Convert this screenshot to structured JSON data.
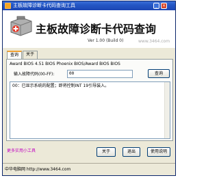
{
  "window": {
    "title": "主板故障诊断卡代码查询工具",
    "minimize_glyph": "_",
    "close_glyph": "×"
  },
  "header": {
    "app_title": "主板故障诊断卡代码查询",
    "version": "Ver 1.00 (Build 0)",
    "watermark": "www.3464.com",
    "logo_icon": "first-aid-kit-icon"
  },
  "tabs": [
    {
      "label": "查询"
    },
    {
      "label": "关于"
    }
  ],
  "panel": {
    "bios_line": "Award BIOS 4.51 BIOS Phoenix BIOS/Award BIOS BIOS",
    "code_label": "输入故障代码(00-FF):",
    "code_value": "00",
    "query_button": "查询",
    "result_text": "00：已显示系统的配置；即将控制INT 19引导装入。"
  },
  "bottom": {
    "link_text": "更多实用小工具",
    "about_button": "关于",
    "exit_button": "退出",
    "help_button": "使用说明"
  },
  "status": {
    "text": "中华电脑网 http://www.3464.com"
  },
  "colors": {
    "titlebar": "#2457c5",
    "tab_accent": "#f0a030",
    "link": "#c000c0"
  }
}
